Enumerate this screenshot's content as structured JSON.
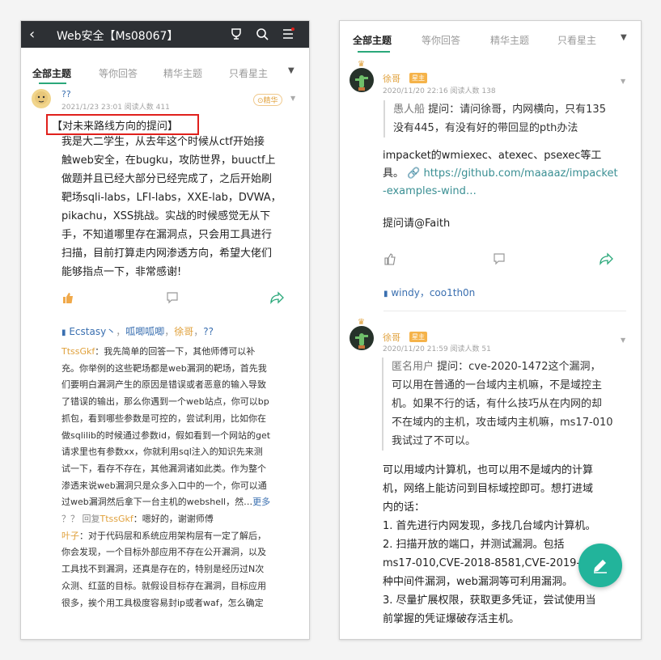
{
  "left": {
    "header": {
      "title": "Web安全【Ms08067】"
    },
    "tabs": [
      "全部主题",
      "等你回答",
      "精华主题",
      "只看星主"
    ],
    "post": {
      "author": "??",
      "meta": "2021/1/23 23:01  阅读人数 411",
      "badge": "精华",
      "highlight": "【对未来路线方向的提问】",
      "body_lines": [
        "我是大二学生，从去年这个时候从ctf开始接",
        "触web安全，在bugku，攻防世界，buuctf上",
        "做题并且已经大部分已经完成了，之后开始刷",
        "靶场sqli-labs，LFI-labs，XXE-lab，DVWA，",
        "pikachu，XSS挑战。实战的时候感觉无从下",
        "手，不知道哪里存在漏洞点，只会用工具进行",
        "扫描，目前打算走内网渗透方向，希望大佬们",
        "能够指点一下，非常感谢!"
      ],
      "likes": {
        "users": [
          "Ecstasy丶",
          "呱唧呱唧",
          "徐哥",
          "??"
        ],
        "separator": "，"
      },
      "comments": [
        {
          "author": "TtssGkf",
          "lines": [
            "：我先简单的回答一下，其他师傅可以补",
            "充。你举例的这些靶场都是web漏洞的靶场，首先我",
            "们要明白漏洞产生的原因是错误或者恶意的输入导致",
            "了错误的输出，那么你遇到一个web站点，你可以bp",
            "抓包，看到哪些参数是可控的，尝试利用，比如你在",
            "做sqlilib的时候通过参数id，假如看到一个网站的get",
            "请求里也有参数xx，你就利用sql注入的知识先来测",
            "试一下，看存不存在，其他漏洞诸如此类。作为整个",
            "渗透来说web漏洞只是众多入口中的一个，你可以通",
            "过web漏洞然后拿下一台主机的webshell，然…"
          ],
          "more": "更多"
        }
      ],
      "reply": {
        "from": "？？",
        "verb": "回复",
        "to": "TtssGkf",
        "text": "：嗯好的，谢谢师傅"
      },
      "comment2": {
        "author": "叶子",
        "lines": [
          "：对于代码层和系统应用架构层有一定了解后，",
          "你会发现，一个目标外部应用不存在公开漏洞，以及",
          "工具找不到漏洞，还真是存在的，特别是经历过N次",
          "众测、红蓝的目标。就假设目标存在漏洞，目标应用",
          "很多，挨个用工具极度容易封ip或者waf，怎么确定"
        ]
      }
    }
  },
  "right": {
    "tabs": [
      "全部主题",
      "等你回答",
      "精华主题",
      "只看星主"
    ],
    "posts": [
      {
        "author": "徐哥",
        "badge": "星主",
        "meta": "2020/11/20 22:16  阅读人数 138",
        "quote_author": "愚人船",
        "quote_lines": [
          "提问：请问徐哥，内网横向，只有135",
          "没有445，有没有好的带回显的pth办法"
        ],
        "body_lines": [
          "impacket的wmiexec、atexec、psexec等工",
          "具。"
        ],
        "link_lines": [
          "https://github.com/maaaaz/impacket",
          "-examples-wind…"
        ],
        "extra": "提问请@Faith",
        "likes": "windy，coo1th0n"
      },
      {
        "author": "徐哥",
        "badge": "星主",
        "meta": "2020/11/20 21:59  阅读人数 51",
        "quote_author": "匿名用户",
        "quote_lines": [
          "提问：cve-2020-1472这个漏洞，",
          "可以用在普通的一台域内主机嘛，不是域控主",
          "机。如果不行的话，有什么技巧从在内网的却",
          "不在域内的主机，攻击域内主机嘛，ms17-010",
          "我试过了不可以。"
        ],
        "body_lines": [
          "可以用域内计算机，也可以用不是域内的计算",
          "机，网络上能访问到目标域控即可。想打进域",
          "内的话：",
          "1. 首先进行内网发现，多找几台域内计算机。",
          "2. 扫描开放的端口，并测试漏洞。包括",
          "ms17-010,CVE-2018-8581,CVE-2019-0",
          "种中间件漏洞，web漏洞等可利用漏洞。",
          "3. 尽量扩展权限，获取更多凭证，尝试使用当",
          "前掌握的凭证爆破存活主机。"
        ]
      }
    ]
  },
  "colors": {
    "accent": "#2aa87a",
    "link": "#3a8f93",
    "highlight_box": "#e0201c",
    "header": "#2d3034",
    "fab": "#22b49b"
  }
}
